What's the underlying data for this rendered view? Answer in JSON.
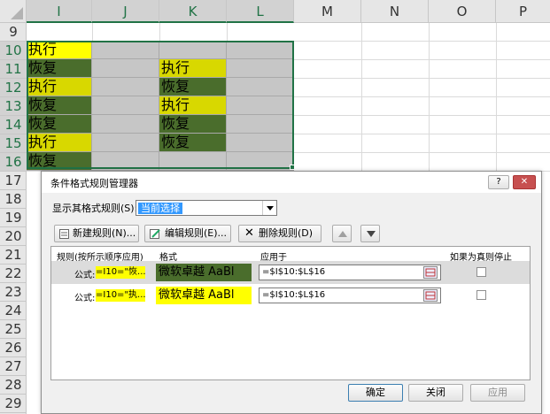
{
  "sheet": {
    "columns": [
      "I",
      "J",
      "K",
      "L",
      "M",
      "N",
      "O",
      "P"
    ],
    "rows": [
      "9",
      "10",
      "11",
      "12",
      "13",
      "14",
      "15",
      "16",
      "17",
      "18",
      "19",
      "20",
      "21",
      "22",
      "23",
      "24",
      "25",
      "26",
      "27",
      "28",
      "29"
    ],
    "cells": {
      "I10": "执行",
      "I11": "恢复",
      "I12": "执行",
      "I13": "恢复",
      "I14": "恢复",
      "I15": "执行",
      "I16": "恢复",
      "K11": "执行",
      "K12": "恢复",
      "K13": "执行",
      "K14": "恢复",
      "K15": "恢复"
    }
  },
  "colors": {
    "execute_fill": "#ffff00",
    "execute_fill_alt": "#d8d800",
    "recover_fill": "#4a6d2c",
    "selection_gray": "#c6c6c6",
    "accent": "#217346"
  },
  "dialog": {
    "title": "条件格式规则管理器",
    "help_label": "?",
    "close_label": "✕",
    "show_rules_label": "显示其格式规则(S):",
    "show_rules_value": "当前选择",
    "toolbar": {
      "new_rule": "新建规则(N)...",
      "edit_rule": "编辑规则(E)...",
      "delete_rule": "删除规则(D)"
    },
    "headers": {
      "rule": "规则(按所示顺序应用)",
      "format": "格式",
      "applies_to": "应用于",
      "stop_if_true": "如果为真则停止"
    },
    "rules": [
      {
        "label": "公式:",
        "formula": "=I10=\"恢...",
        "preview": "微软卓越  AaBl",
        "applies_to": "=$I$10:$L$16"
      },
      {
        "label": "公式:",
        "formula": "=I10=\"执...",
        "preview": "微软卓越  AaBl",
        "applies_to": "=$I$10:$L$16"
      }
    ],
    "buttons": {
      "ok": "确定",
      "close": "关闭",
      "apply": "应用"
    }
  }
}
